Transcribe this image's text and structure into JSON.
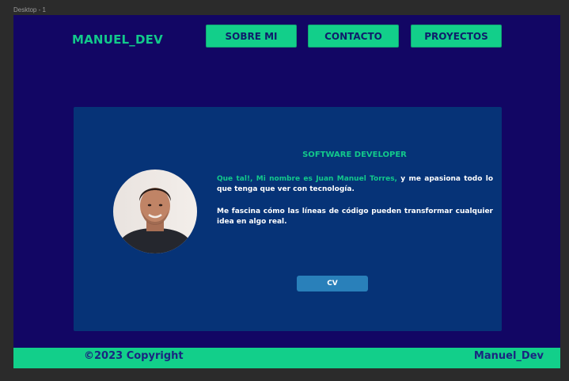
{
  "canvas": {
    "label": "Desktop - 1"
  },
  "header": {
    "brand": "MANUEL_DEV",
    "nav": [
      {
        "label": "SOBRE MI"
      },
      {
        "label": "CONTACTO"
      },
      {
        "label": "PROYECTOS"
      }
    ]
  },
  "main": {
    "title": "SOFTWARE DEVELOPER",
    "intro_highlight": "Que tal!, Mi nombre es Juan Manuel Torres,",
    "intro_rest": " y me apasiona todo lo que tenga que ver con tecnología.",
    "paragraph2": "Me fascina cómo las líneas de código pueden transformar cualquier idea en algo real.",
    "cv_label": "CV"
  },
  "footer": {
    "copyright": "©2023 Copyright",
    "name": "Manuel_Dev"
  },
  "colors": {
    "background": "#120664",
    "accent": "#12cf8a",
    "card": "#063377",
    "cv_button": "#2980ba"
  }
}
